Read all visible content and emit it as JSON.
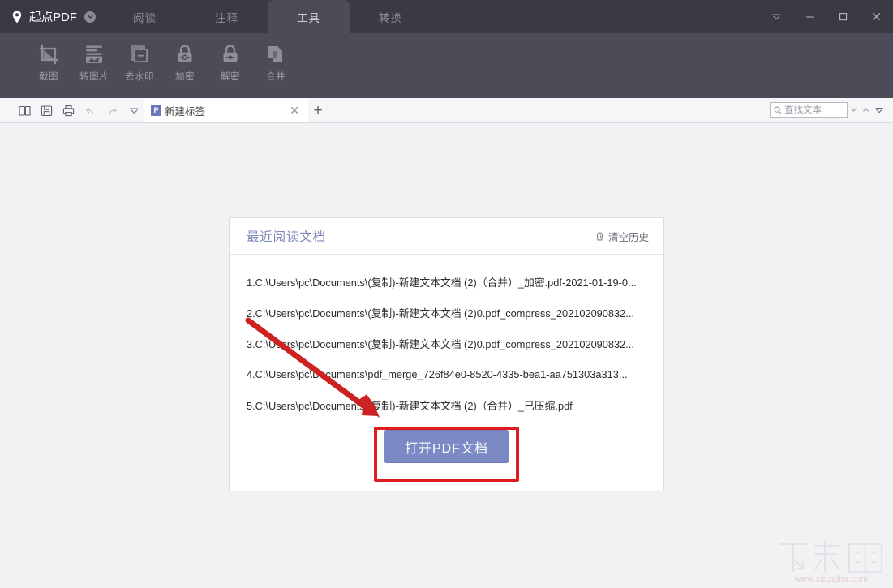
{
  "app": {
    "brand_name": "起点PDF",
    "brand_logo_icon": "location-pin-icon",
    "brand_caret_icon": "chevron-down-circle-icon"
  },
  "titlebar": {
    "tabs": [
      {
        "label": "阅读",
        "active": false,
        "name": "tab-read"
      },
      {
        "label": "注释",
        "active": false,
        "name": "tab-annotate"
      },
      {
        "label": "工具",
        "active": true,
        "name": "tab-tools"
      },
      {
        "label": "转换",
        "active": false,
        "name": "tab-convert"
      }
    ],
    "window_controls": [
      {
        "icon": "collapse-ribbon-icon",
        "name": "collapse-ribbon-button"
      },
      {
        "icon": "minimize-icon",
        "name": "minimize-button"
      },
      {
        "icon": "maximize-icon",
        "name": "maximize-button"
      },
      {
        "icon": "close-icon",
        "name": "close-button"
      }
    ]
  },
  "ribbon": {
    "tools": [
      {
        "label": "截图",
        "icon": "crop-icon",
        "name": "tool-screenshot"
      },
      {
        "label": "转图片",
        "icon": "image-convert-icon",
        "name": "tool-to-image"
      },
      {
        "label": "去水印",
        "icon": "remove-watermark-icon",
        "name": "tool-remove-watermark"
      },
      {
        "label": "加密",
        "icon": "lock-closed-icon",
        "name": "tool-encrypt"
      },
      {
        "label": "解密",
        "icon": "lock-open-icon",
        "name": "tool-decrypt"
      },
      {
        "label": "合并",
        "icon": "merge-icon",
        "name": "tool-merge"
      }
    ]
  },
  "subbar": {
    "icons": [
      {
        "icon": "book-open-icon",
        "name": "view-mode-button",
        "disabled": false
      },
      {
        "icon": "save-icon",
        "name": "save-button",
        "disabled": false
      },
      {
        "icon": "print-icon",
        "name": "print-button",
        "disabled": false
      },
      {
        "icon": "undo-icon",
        "name": "undo-button",
        "disabled": true
      },
      {
        "icon": "redo-icon",
        "name": "redo-button",
        "disabled": true
      },
      {
        "icon": "chevron-down-icon",
        "name": "more-tools-button",
        "disabled": false
      }
    ],
    "doc_tab": {
      "badge": "P",
      "label": "新建标签",
      "close_icon": "close-icon",
      "add_icon": "plus-icon"
    },
    "search": {
      "placeholder": "查找文本",
      "value": "",
      "icon": "search-icon",
      "prev_icon": "chevron-down-small-icon",
      "next_icon": "chevron-up-small-icon",
      "more_icon": "chevron-double-down-icon"
    }
  },
  "card": {
    "title": "最近阅读文档",
    "clear_label": "清空历史",
    "clear_icon": "trash-icon",
    "recent_files": [
      "1.C:\\Users\\pc\\Documents\\(复制)-新建文本文档 (2)（合并）_加密.pdf-2021-01-19-0...",
      "2.C:\\Users\\pc\\Documents\\(复制)-新建文本文档 (2)0.pdf_compress_202102090832...",
      "3.C:\\Users\\pc\\Documents\\(复制)-新建文本文档 (2)0.pdf_compress_202102090832...",
      "4.C:\\Users\\pc\\Documents\\pdf_merge_726f84e0-8520-4335-bea1-aa751303a313...",
      "5.C:\\Users\\pc\\Documents\\(复制)-新建文本文档 (2)（合并）_已压缩.pdf"
    ],
    "open_button_label": "打开PDF文档"
  },
  "annotations": {
    "highlight_color": "#e01b1b",
    "arrow_color": "#cc2222"
  },
  "watermark": {
    "text": "下载吧",
    "url": "www.xiazaiba.com"
  },
  "colors": {
    "titlebar_bg": "#3a3a45",
    "ribbon_bg": "#4c4c59",
    "content_bg": "#f2f1f4",
    "accent": "#7b89c4",
    "card_title": "#7b8ab8"
  }
}
